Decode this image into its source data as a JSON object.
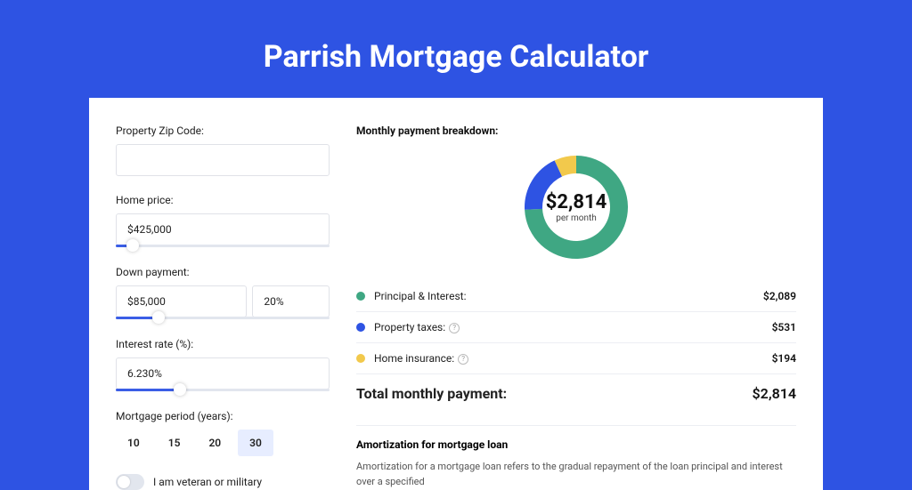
{
  "page": {
    "title": "Parrish Mortgage Calculator"
  },
  "form": {
    "zip": {
      "label": "Property Zip Code:",
      "value": ""
    },
    "home_price": {
      "label": "Home price:",
      "value": "$425,000",
      "slider_pct": 8
    },
    "down_payment": {
      "label": "Down payment:",
      "value": "$85,000",
      "pct": "20%",
      "slider_pct": 20
    },
    "interest": {
      "label": "Interest rate (%):",
      "value": "6.230%",
      "slider_pct": 30
    },
    "period": {
      "label": "Mortgage period (years):",
      "options": [
        "10",
        "15",
        "20",
        "30"
      ],
      "active": 3
    },
    "veteran": {
      "label": "I am veteran or military",
      "checked": false
    }
  },
  "breakdown": {
    "title": "Monthly payment breakdown:",
    "center_amount": "$2,814",
    "center_sub": "per month",
    "items": [
      {
        "label": "Principal & Interest:",
        "value": "$2,089",
        "color": "#3fa783",
        "help": false
      },
      {
        "label": "Property taxes:",
        "value": "$531",
        "color": "#2e53e3",
        "help": true
      },
      {
        "label": "Home insurance:",
        "value": "$194",
        "color": "#f2c94c",
        "help": true
      }
    ],
    "total_label": "Total monthly payment:",
    "total_value": "$2,814"
  },
  "amort": {
    "title": "Amortization for mortgage loan",
    "text": "Amortization for a mortgage loan refers to the gradual repayment of the loan principal and interest over a specified"
  },
  "chart_data": {
    "type": "pie",
    "title": "Monthly payment breakdown",
    "series": [
      {
        "name": "Principal & Interest",
        "value": 2089,
        "color": "#3fa783"
      },
      {
        "name": "Property taxes",
        "value": 531,
        "color": "#2e53e3"
      },
      {
        "name": "Home insurance",
        "value": 194,
        "color": "#f2c94c"
      }
    ],
    "total": 2814
  }
}
